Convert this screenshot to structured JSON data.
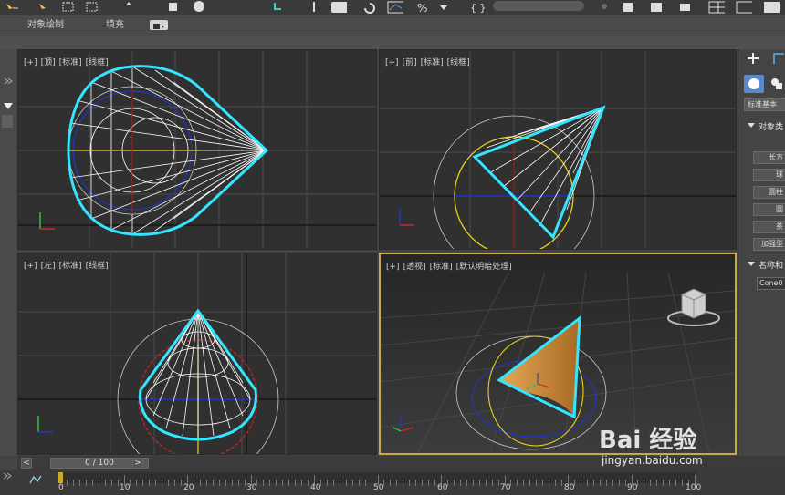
{
  "menu": {
    "object_paint": "对象绘制",
    "fill": "填充"
  },
  "viewports": {
    "top": {
      "plus": "[+]",
      "view": "[顶]",
      "shading": "[标准]",
      "mode": "[线框]"
    },
    "front": {
      "plus": "[+]",
      "view": "[前]",
      "shading": "[标准]",
      "mode": "[线框]"
    },
    "left": {
      "plus": "[+]",
      "view": "[左]",
      "shading": "[标准]",
      "mode": "[线框]"
    },
    "perspective": {
      "plus": "[+]",
      "view": "[透视]",
      "shading": "[标准]",
      "mode": "[默认明暗处理]"
    }
  },
  "command_panel": {
    "dropdown": "标准基本",
    "object_type_header": "对象类",
    "buttons": [
      "长方",
      "球",
      "圆柱",
      "圆",
      "茶",
      "加强型"
    ],
    "name_color_header": "名称和",
    "object_name": "Cone0"
  },
  "timeline": {
    "frame_display": "0 / 100",
    "prev": "<",
    "next": ">",
    "ticks": [
      "0",
      "10",
      "20",
      "30",
      "40",
      "50",
      "60",
      "70",
      "80",
      "90",
      "100"
    ]
  },
  "watermark": {
    "logo": "Bai 经验",
    "url": "jingyan.baidu.com"
  },
  "colors": {
    "selection": "#33e6ff",
    "active_border": "#c8a84b",
    "cone_fill": "#c98a3a"
  }
}
